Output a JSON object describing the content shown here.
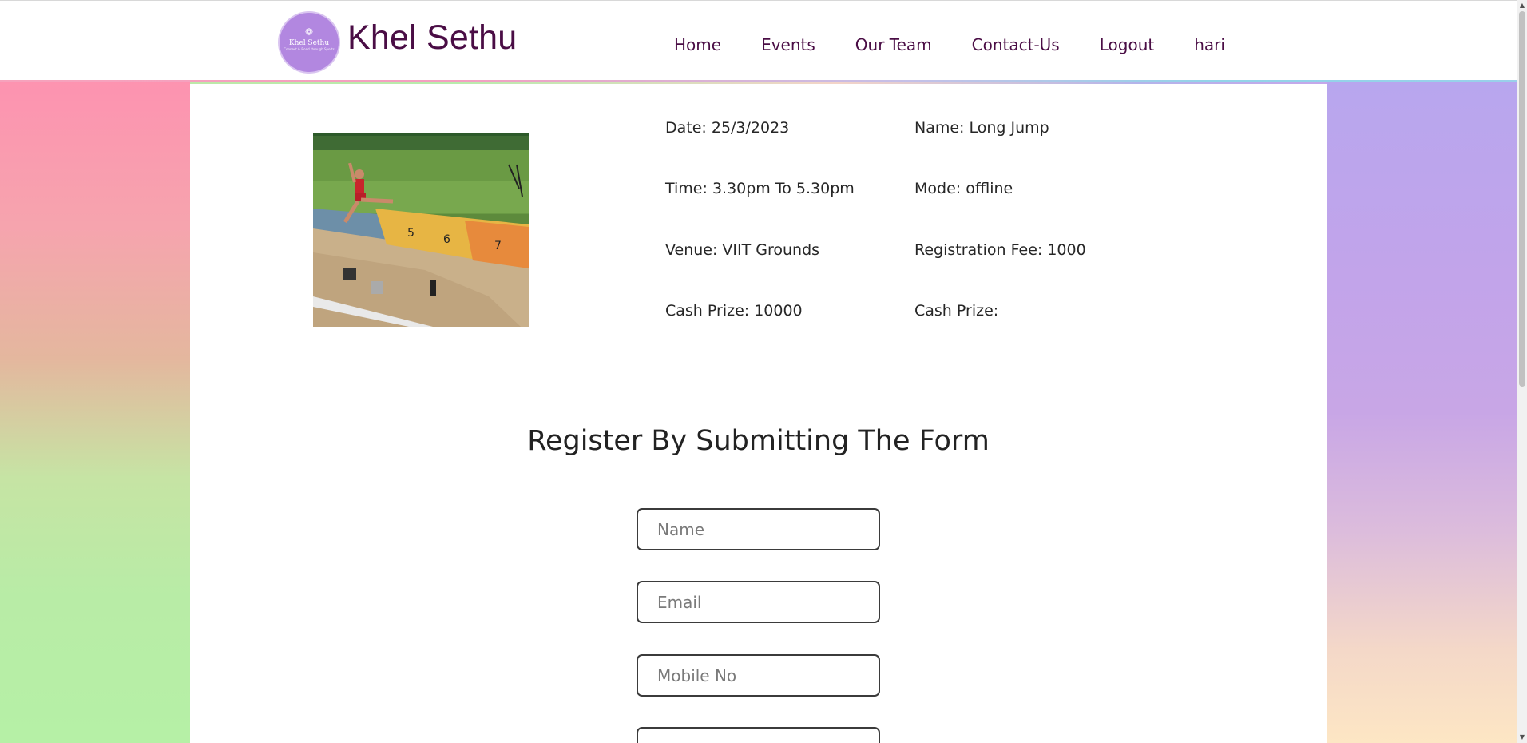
{
  "brand": {
    "name": "Khel Sethu",
    "logo_text": "Khel Sethu",
    "logo_tagline": "Connect & Bond through Sports"
  },
  "nav": {
    "items": [
      "Home",
      "Events",
      "Our Team",
      "Contact-Us",
      "Logout",
      "hari"
    ]
  },
  "event": {
    "image_alt": "Long jump athlete mid-air over sand pit",
    "date": "Date: 25/3/2023",
    "name": "Name: Long Jump",
    "time": "Time: 3.30pm To 5.30pm",
    "mode": "Mode: offline",
    "venue": "Venue: VIIT Grounds",
    "registration_fee": "Registration Fee: 1000",
    "cash_prize": "Cash Prize: 10000",
    "cash_prize_2": "Cash Prize:"
  },
  "form": {
    "title": "Register By Submitting The Form",
    "name_placeholder": "Name",
    "email_placeholder": "Email",
    "mobile_placeholder": "Mobile No",
    "name_value": "",
    "email_value": "",
    "mobile_value": ""
  },
  "colors": {
    "brand": "#4a0d45",
    "logo_bg": "#b287e0"
  },
  "icons": {
    "logo": "khel-sethu-logo-icon",
    "scroll_up": "chevron-up-icon",
    "scroll_down": "chevron-down-icon"
  }
}
